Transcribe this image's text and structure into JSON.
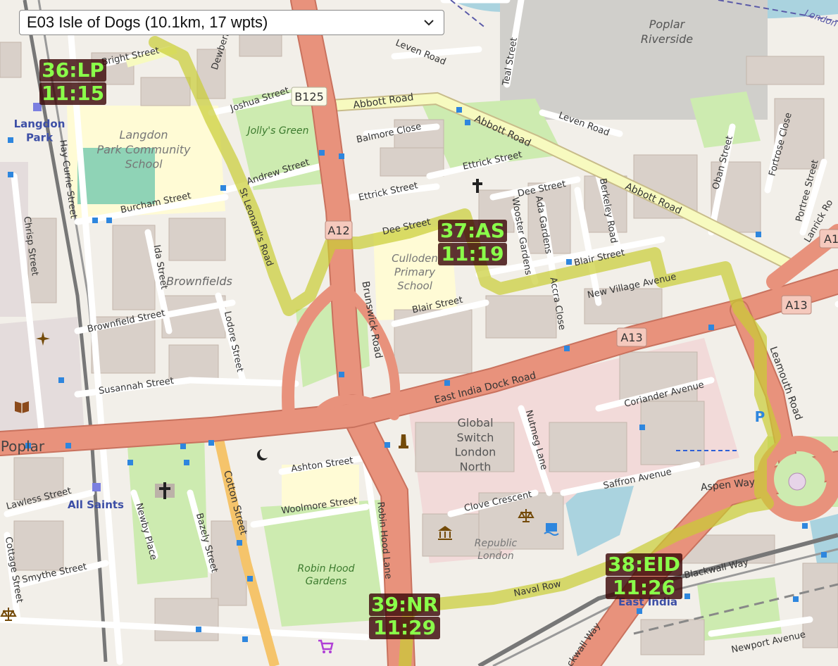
{
  "route_select": {
    "selected": "E03 Isle of Dogs (10.1km, 17 wpts)"
  },
  "waypoints": [
    {
      "code": "36:LP",
      "time": "11:15"
    },
    {
      "code": "37:AS",
      "time": "11:19"
    },
    {
      "code": "38:EID",
      "time": "11:26"
    },
    {
      "code": "39:NR",
      "time": "11:29"
    }
  ],
  "map_labels": {
    "poplar_riverside": "Poplar\nRiverside",
    "langdon_park": "Langdon\nPark",
    "langdon_school": "Langdon\nPark Community\nSchool",
    "jollys_green": "Jolly's Green",
    "brownfields": "Brownfields",
    "culloden_school": "Culloden\nPrimary\nSchool",
    "global_switch": "Global\nSwitch\nLondon\nNorth",
    "poplar": "Poplar",
    "all_saints": "All Saints",
    "robin_hood_gardens": "Robin Hood\nGardens",
    "republic_london": "Republic\nLondon",
    "east_india": "East India",
    "b125": "B125",
    "a12": "A12",
    "a13_upper": "A13",
    "a13_lower": "A13",
    "a1": "A1",
    "london_e": "London E"
  },
  "streets": {
    "bright_street": "Bright Street",
    "dewberry": "Dewberry",
    "joshua_street": "Joshua Street",
    "leven_road_top": "Leven Road",
    "leven_road_right": "Leven Road",
    "teal_street": "Teal Street",
    "abbott_road_1": "Abbott Road",
    "abbott_road_2": "Abbott Road",
    "abbott_road_3": "Abbott Road",
    "balmore_close": "Balmore Close",
    "andrew_street": "Andrew Street",
    "burcham_street": "Burcham Street",
    "st_leonards_road": "St Leonard's Road",
    "hay_currie_street": "Hay Currie Street",
    "chrisp_street": "Chrisp Street",
    "ida_street": "Ida Street",
    "ettrick_street_1": "Ettrick Street",
    "ettrick_street_2": "Ettrick Street",
    "dee_street_1": "Dee Street",
    "dee_street_2": "Dee Street",
    "wooster_gardens": "Wooster Gardens",
    "ada_gardens": "Ada Gardens",
    "berkeley_road": "Berkeley Road",
    "blair_street_1": "Blair Street",
    "blair_street_2": "Blair Street",
    "new_village_avenue": "New Village Avenue",
    "accra_close": "Accra Close",
    "oban_street": "Oban Street",
    "fortrose_close": "Fortrose Close",
    "portree_street": "Portree Street",
    "lanrick_road": "Lanrick Ro",
    "brownfield_street": "Brownfield Street",
    "lodore_street": "Lodore Street",
    "brunswick_road": "Brunswick Road",
    "susannah_street": "Susannah Street",
    "east_india_dock_road": "East India Dock Road",
    "coriander_avenue": "Coriander Avenue",
    "leamouth_road": "Leamouth Road",
    "nutmeg_lane": "Nutmeg Lane",
    "saffron_avenue": "Saffron Avenue",
    "aspen_way": "Aspen Way",
    "ashton_street": "Ashton Street",
    "cotton_street": "Cotton Street",
    "woolmore_street": "Woolmore Street",
    "robin_hood_lane": "Robin Hood Lane",
    "clove_crescent": "Clove Crescent",
    "lawless_street": "Lawless Street",
    "newby_place": "Newby Place",
    "bazely_street": "Bazely Street",
    "cottage_street": "Cottage Street",
    "smythe_street": "Smythe Street",
    "naval_row": "Naval Row",
    "blackwall_way": "Blackwall Way",
    "newport_avenue": "Newport Avenue",
    "ckwall_way": "ckwall Way"
  },
  "icons": {
    "place_of_worship": "cross-icon",
    "mosque": "crescent-icon",
    "library": "book-icon",
    "parking": "parking-icon",
    "monument": "monument-icon",
    "courthouse": "scales-icon",
    "shop": "cart-icon",
    "bus_stop": "bus-stop-icon"
  },
  "colors": {
    "route": "#c9cd33",
    "primary_road": "#e8927c",
    "secondary_road": "#f7fabf",
    "park": "#cdebb0",
    "school": "#fffbd5",
    "water": "#aad3df",
    "building": "#d9d0c9",
    "waypoint_text": "#8aff4a",
    "waypoint_bg": "#3c0808",
    "bus_stop": "#2e86de"
  }
}
